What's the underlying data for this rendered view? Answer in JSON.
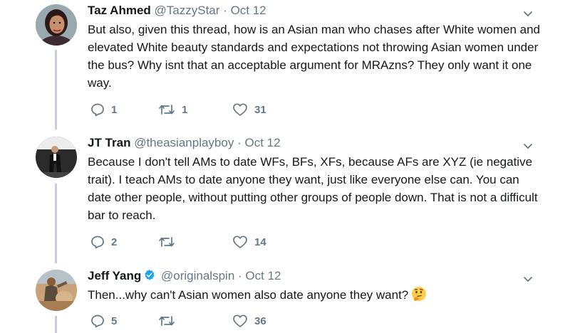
{
  "tweets": [
    {
      "name": "Taz Ahmed",
      "handle": "@TazzyStar",
      "separator": "·",
      "date": "Oct 12",
      "text": "But also, given this thread, how is an Asian man who chases after White women and elevated White beauty standards and expectations not throwing Asian women under the bus? Why isnt that an acceptable argument for MRAzns? They only want it one way.",
      "replies": "1",
      "retweets": "1",
      "likes": "31"
    },
    {
      "name": "JT Tran",
      "handle": "@theasianplayboy",
      "separator": "·",
      "date": "Oct 12",
      "text": "Because I don't tell AMs to date WFs, BFs, XFs, because AFs are XYZ (ie negative trait). I teach AMs to date anyone they want, just like everyone else can. You can date other people, without putting other groups of people down. That is not a difficult bar to reach.",
      "replies": "2",
      "retweets": "",
      "likes": "14"
    },
    {
      "name": "Jeff Yang",
      "handle": "@originalspin",
      "separator": "·",
      "date": "Oct 12",
      "text": "Then...why can't Asian women also date anyone they want?",
      "emoji": "thinking-face",
      "replies": "5",
      "retweets": "",
      "likes": "36",
      "verified": true
    }
  ],
  "colors": {
    "text": "#14171a",
    "muted": "#657786",
    "thread_line": "#c4cfd6",
    "verified": "#1da1f2",
    "avatar_taz_bg": "#9aa8b0",
    "avatar_jt_bg": "#2b2b2b",
    "avatar_jeff_bg": "#c9a27a"
  },
  "icons": [
    "reply-icon",
    "retweet-icon",
    "like-icon",
    "chevron-down-icon",
    "verified-badge-icon",
    "thinking-face-emoji"
  ]
}
